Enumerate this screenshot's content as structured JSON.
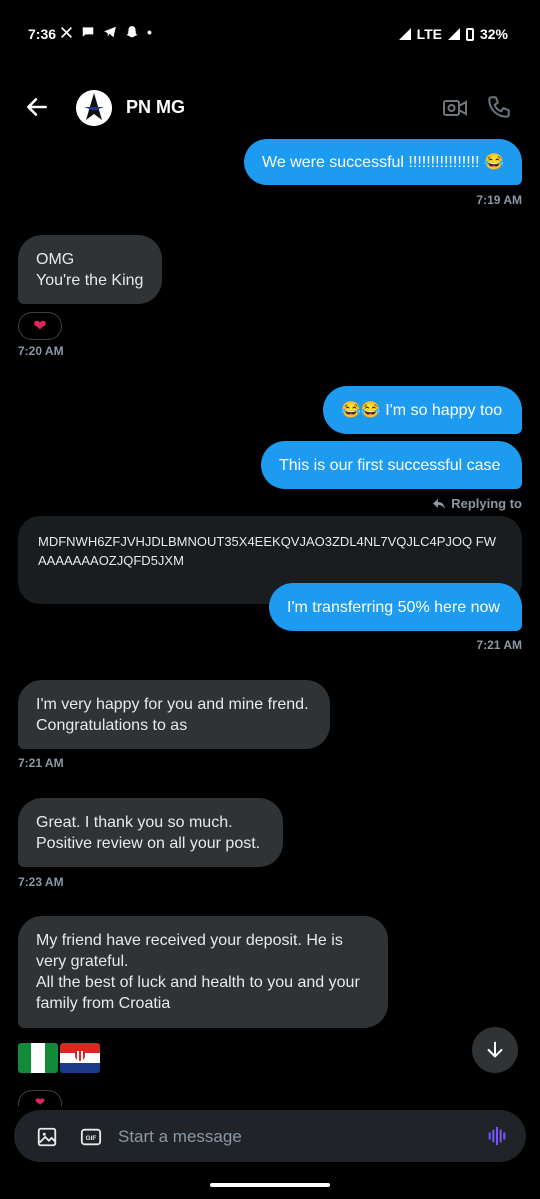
{
  "status_bar": {
    "time": "7:36",
    "network": "LTE",
    "battery": "32%"
  },
  "header": {
    "contact_name": "PN MG"
  },
  "messages": {
    "m1": "We were successful !!!!!!!!!!!!!!!! 😂",
    "m1_time": "7:19 AM",
    "m2_line1": "OMG",
    "m2_line2": "You're the King",
    "m2_reaction": "❤",
    "m2_time": "7:20 AM",
    "m3": "😂😂 I'm so happy too",
    "m4": "This is our first successful case",
    "replying_to": "Replying to",
    "quoted": "MDFNWH6ZFJVHJDLBMNOUT35X4EEKQVJAO3ZDL4NL7VQJLC4PJOQ FWAAAAAAAOZJQFD5JXM",
    "m5": "I'm transferring 50% here now",
    "m5_time": "7:21 AM",
    "m6_line1": "I'm very happy for you and mine frend.",
    "m6_line2": "Congratulations to as",
    "m6_time": "7:21 AM",
    "m7_line1": "Great. I thank you so much.",
    "m7_line2": "Positive review on all your post.",
    "m7_time": "7:23 AM",
    "m8_line1": "My friend have received your deposit. He is",
    "m8_line2": "very grateful.",
    "m8_line3": "All the best of luck and health to you and your",
    "m8_line4": "family from Croatia"
  },
  "composer": {
    "placeholder": "Start a message"
  },
  "colors": {
    "accent": "#1d9bf0",
    "incoming_bubble": "#2f3336",
    "voice_icon": "#7856ff"
  }
}
